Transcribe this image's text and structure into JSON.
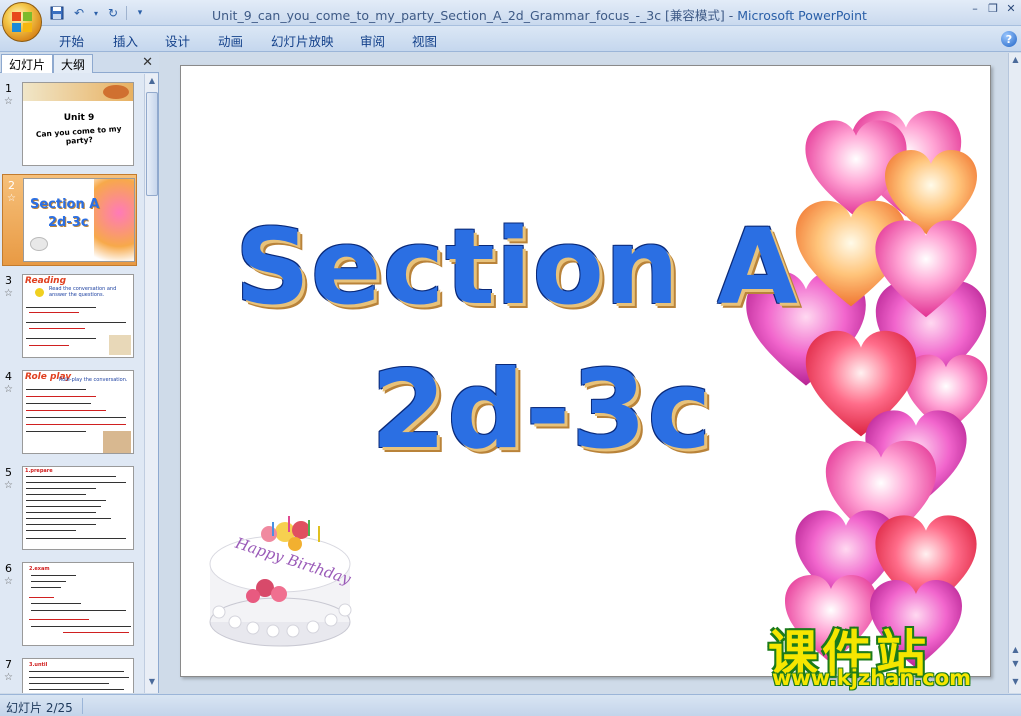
{
  "window": {
    "title": "Unit_9_can_you_come_to_my_party_Section_A_2d_Grammar_focus_-_3c [兼容模式] - ",
    "app_name": "Microsoft PowerPoint"
  },
  "ribbon": {
    "tabs": [
      "开始",
      "插入",
      "设计",
      "动画",
      "幻灯片放映",
      "审阅",
      "视图"
    ]
  },
  "panel": {
    "tab_slides": "幻灯片",
    "tab_outline": "大纲",
    "thumbs": [
      {
        "num": "1",
        "line1": "Unit 9",
        "line2": "Can you come to my party?"
      },
      {
        "num": "2",
        "line1": "Section A",
        "line2": "2d-3c"
      },
      {
        "num": "3",
        "line1": "Reading",
        "line2": "Read the conversation and answer the questions."
      },
      {
        "num": "4",
        "line1": "Role play",
        "line2": "Role-play the conversation."
      },
      {
        "num": "5",
        "line1": "1.prepare"
      },
      {
        "num": "6",
        "line1": "2.exam"
      },
      {
        "num": "7",
        "line1": "3.until"
      }
    ]
  },
  "slide": {
    "title_line1": "Section A",
    "title_line2": "2d-3c",
    "cake_text": "Happy Birthday"
  },
  "watermark": {
    "cn": "课件站",
    "url": "www.kjzhan.com"
  },
  "status": {
    "slide_counter": "幻灯片 2/25"
  }
}
